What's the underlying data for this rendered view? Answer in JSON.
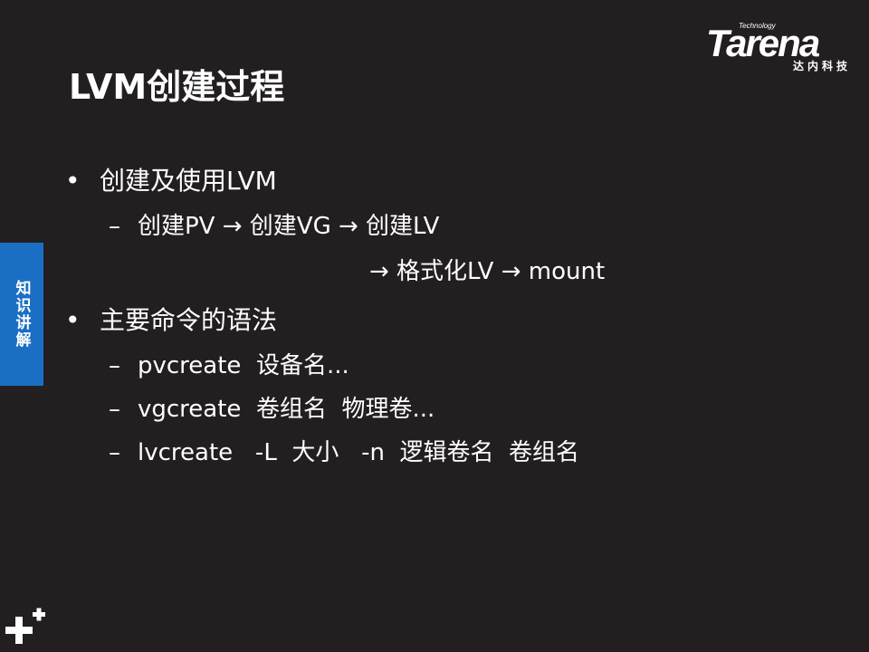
{
  "logo": {
    "small": "Technology",
    "main": "Tarena",
    "sub": "达内科技"
  },
  "title": "LVM创建过程",
  "side_tab": "知识讲解",
  "bullets": [
    {
      "level": 1,
      "marker": "•",
      "text": "创建及使用LVM"
    },
    {
      "level": 2,
      "marker": "–",
      "text": "创建PV → 创建VG → 创建LV"
    },
    {
      "level": 3,
      "marker": "",
      "text": "→ 格式化LV → mount"
    },
    {
      "level": 1,
      "marker": "•",
      "text": "主要命令的语法"
    },
    {
      "level": 2,
      "marker": "–",
      "text": "pvcreate  设备名..."
    },
    {
      "level": 2,
      "marker": "–",
      "text": "vgcreate  卷组名  物理卷..."
    },
    {
      "level": 2,
      "marker": "–",
      "text": "lvcreate   -L  大小   -n  逻辑卷名  卷组名"
    }
  ]
}
